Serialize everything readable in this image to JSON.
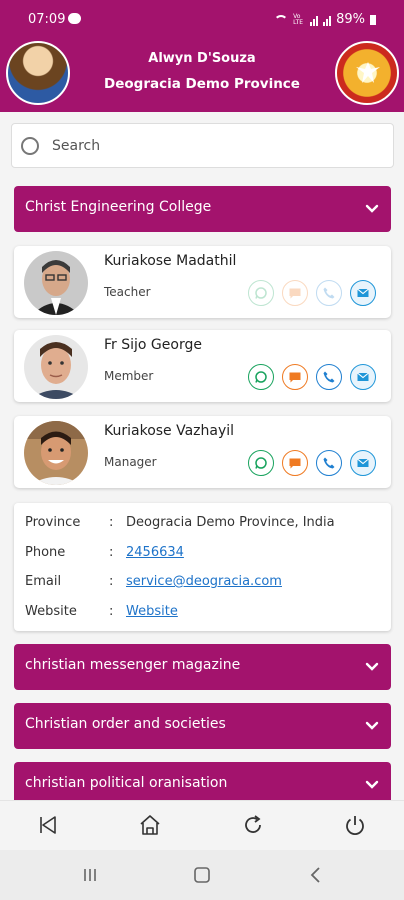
{
  "status": {
    "time": "07:09",
    "network_label": "Vo LTE",
    "battery": "89%"
  },
  "header": {
    "user_name": "Alwyn D'Souza",
    "province": "Deogracia Demo Province"
  },
  "search": {
    "placeholder": "Search",
    "value": ""
  },
  "categories": [
    {
      "label": "Christ Engineering College",
      "expanded": true
    },
    {
      "label": "christian messenger magazine",
      "expanded": false
    },
    {
      "label": "Christian order and societies",
      "expanded": false
    },
    {
      "label": "christian political oranisation",
      "expanded": false
    }
  ],
  "members": [
    {
      "name": "Kuriakose Madathil",
      "role": "Teacher",
      "contact_enabled": false
    },
    {
      "name": "Fr Sijo George",
      "role": "Member",
      "contact_enabled": true
    },
    {
      "name": "Kuriakose Vazhayil",
      "role": "Manager",
      "contact_enabled": true
    }
  ],
  "details": {
    "province_label": "Province",
    "province_value": "Deogracia Demo Province, India",
    "phone_label": "Phone",
    "phone_value": "2456634",
    "email_label": "Email",
    "email_value": "service@deogracia.com",
    "website_label": "Website",
    "website_value": "Website",
    "separator": ":"
  },
  "icons": {
    "whatsapp": "whatsapp-icon",
    "chat": "chat-icon",
    "call": "phone-icon",
    "mail": "mail-icon",
    "nav_back": "back-icon",
    "nav_home": "home-icon",
    "nav_refresh": "refresh-icon",
    "nav_power": "power-icon"
  },
  "colors": {
    "brand": "#a3136d",
    "whatsapp": "#19a35e",
    "chat": "#ef7a22",
    "call": "#1f7fd0",
    "mail": "#1f96d8",
    "link": "#1e73c9"
  }
}
